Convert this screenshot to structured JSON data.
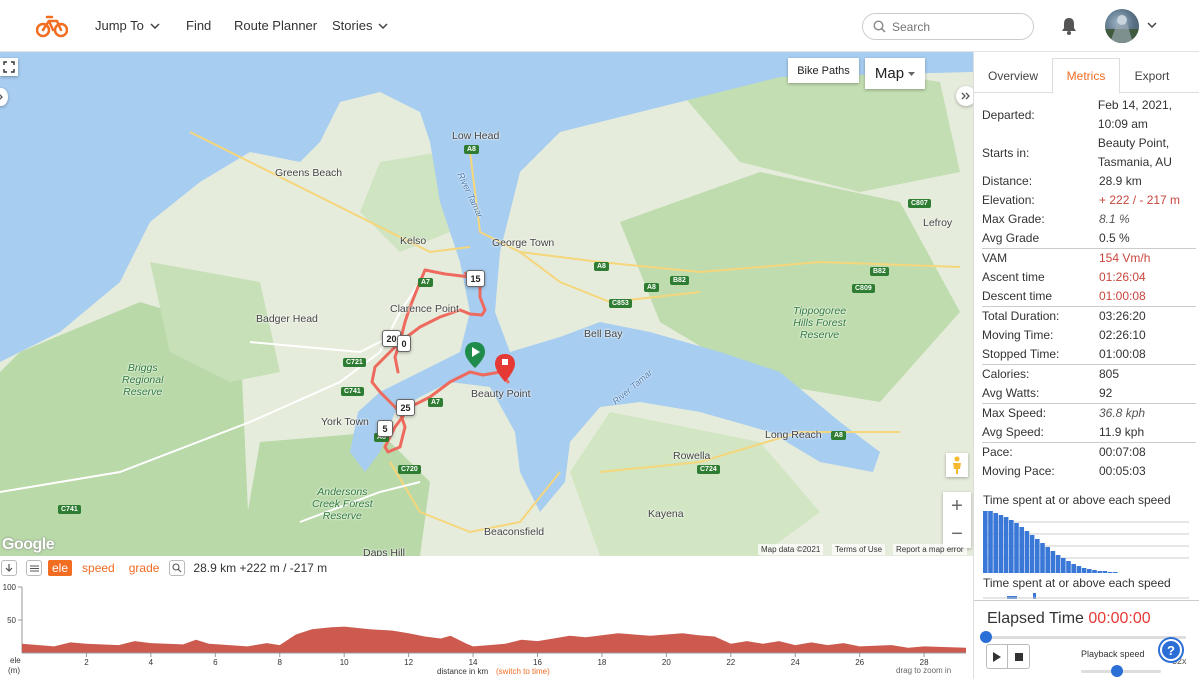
{
  "header": {
    "nav": [
      {
        "label": "Jump To",
        "dropdown": true
      },
      {
        "label": "Find",
        "dropdown": false
      },
      {
        "label": "Route Planner",
        "dropdown": false
      },
      {
        "label": "Stories",
        "dropdown": true
      }
    ],
    "search_placeholder": "Search",
    "brand_color": "#f26c22"
  },
  "map": {
    "controls": {
      "layer_button": "Bike Paths",
      "map_type": "Map",
      "zoom_in": "+",
      "zoom_out": "−"
    },
    "labels": {
      "low_head": "Low Head",
      "greens_beach": "Greens Beach",
      "kelso": "Kelso",
      "george_town": "George Town",
      "clarence_point": "Clarence Point",
      "badger_head": "Badger Head",
      "bell_bay": "Bell Bay",
      "beauty_point": "Beauty Point",
      "york_town": "York Town",
      "long_reach": "Long Reach",
      "rowella": "Rowella",
      "kayena": "Kayena",
      "beaconsfield": "Beaconsfield",
      "lefroy": "Lefroy",
      "daps_hill": "Daps Hill",
      "briggs": "Briggs\nRegional\nReserve",
      "andersons": "Andersons\nCreek Forest\nReserve",
      "tippogoree": "Tippogoree\nHills Forest\nReserve",
      "river_tamar_1": "River Tamar",
      "river_tamar_2": "River Tamar"
    },
    "road_badges": [
      "A8",
      "A8",
      "A8",
      "B82",
      "B82",
      "C807",
      "C809",
      "C853",
      "A7",
      "A7",
      "C721",
      "C741",
      "C741",
      "C720",
      "C724",
      "A8",
      "A8"
    ],
    "route_markers": [
      "15",
      "20",
      "0",
      "25",
      "5"
    ],
    "attribution": {
      "data": "Map data ©2021",
      "terms": "Terms of Use",
      "report": "Report a map error"
    },
    "google": "Google"
  },
  "elevation": {
    "modes": [
      "ele",
      "speed",
      "grade"
    ],
    "active_mode": "ele",
    "summary": "28.9 km +222 m / -217 m",
    "y_ticks": [
      "100",
      "50"
    ],
    "y_label_1": "ele",
    "y_label_2": "(m)",
    "x_ticks": [
      "2",
      "4",
      "6",
      "8",
      "10",
      "12",
      "14",
      "16",
      "18",
      "20",
      "22",
      "24",
      "26",
      "28"
    ],
    "x_label": "distance in km",
    "switch_label": "(switch to time)",
    "zoom_hint": "drag to zoom in",
    "fill_color": "#cc5a4f"
  },
  "sidebar": {
    "tabs": [
      "Overview",
      "Metrics",
      "Export"
    ],
    "active_tab": "Metrics",
    "metrics": {
      "departed": {
        "label": "Departed:",
        "value": "Feb 14, 2021, 10:09 am"
      },
      "starts_in": {
        "label": "Starts in:",
        "value": "Beauty Point, Tasmania, AU"
      },
      "distance": {
        "label": "Distance:",
        "value": "28.9 km"
      },
      "elevation": {
        "label": "Elevation:",
        "value": "+ 222 / - 217 m"
      },
      "max_grade": {
        "label": "Max Grade:",
        "value": "8.1 %"
      },
      "avg_grade": {
        "label": "Avg Grade",
        "value": "0.5 %"
      },
      "vam": {
        "label": "VAM",
        "value": "154 Vm/h"
      },
      "ascent_time": {
        "label": "Ascent time",
        "value": "01:26:04"
      },
      "descent_time": {
        "label": "Descent time",
        "value": "01:00:08"
      },
      "total_duration": {
        "label": "Total Duration:",
        "value": "03:26:20"
      },
      "moving_time": {
        "label": "Moving Time:",
        "value": "02:26:10"
      },
      "stopped_time": {
        "label": "Stopped Time:",
        "value": "01:00:08"
      },
      "calories": {
        "label": "Calories:",
        "value": "805"
      },
      "avg_watts": {
        "label": "Avg Watts:",
        "value": "92"
      },
      "max_speed": {
        "label": "Max Speed:",
        "value": "36.8 kph"
      },
      "avg_speed": {
        "label": "Avg Speed:",
        "value": "11.9 kph"
      },
      "pace": {
        "label": "Pace:",
        "value": "00:07:08"
      },
      "moving_pace": {
        "label": "Moving Pace:",
        "value": "00:05:03"
      }
    },
    "histogram_title_1": "Time spent at or above each speed",
    "histogram_title_2": "Time spent at or above each speed",
    "playback": {
      "elapsed_label": "Elapsed Time",
      "elapsed_value": "00:00:00",
      "speed_label": "Playback speed",
      "speed_value": "32x",
      "progress": 0
    }
  }
}
